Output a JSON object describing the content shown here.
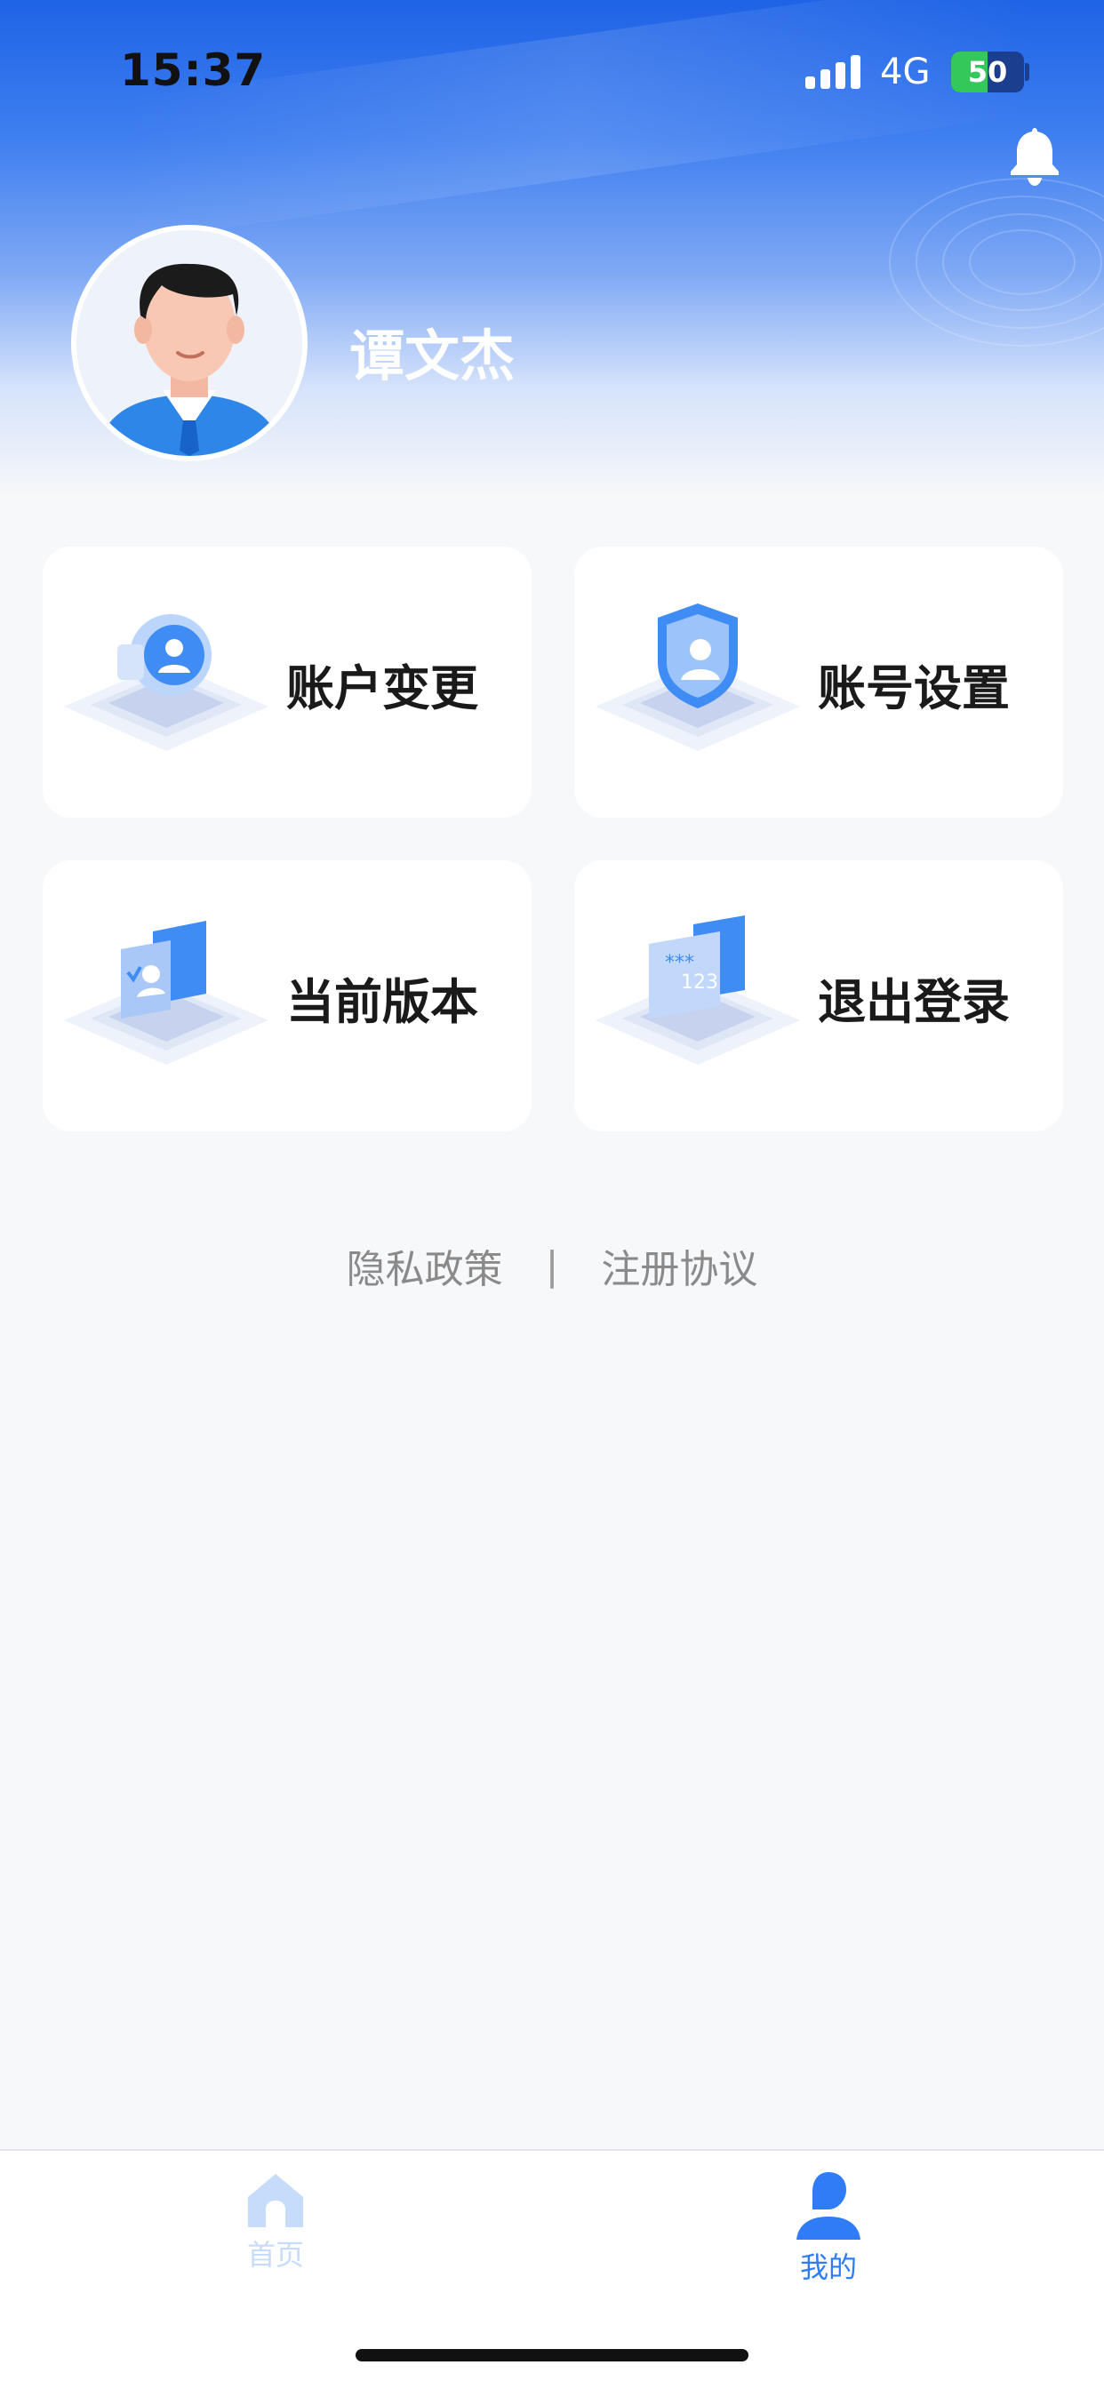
{
  "status_bar": {
    "time": "15:37",
    "network": "4G",
    "battery": "50",
    "battery_level": 0.5
  },
  "profile": {
    "name": "谭文杰"
  },
  "menu": [
    {
      "label": "账户变更",
      "icon": "account-change-icon"
    },
    {
      "label": "账号设置",
      "icon": "account-settings-icon"
    },
    {
      "label": "当前版本",
      "icon": "current-version-icon"
    },
    {
      "label": "退出登录",
      "icon": "logout-icon"
    }
  ],
  "links": {
    "privacy": "隐私政策",
    "separator": "|",
    "register": "注册协议"
  },
  "tabbar": {
    "home": {
      "label": "首页",
      "icon": "home-icon",
      "color": "#c7dcfa"
    },
    "mine": {
      "label": "我的",
      "icon": "person-icon",
      "color": "#2f7cf6",
      "active": true
    }
  },
  "colors": {
    "accent": "#2f7cf6",
    "header_top": "#1f63e6"
  }
}
